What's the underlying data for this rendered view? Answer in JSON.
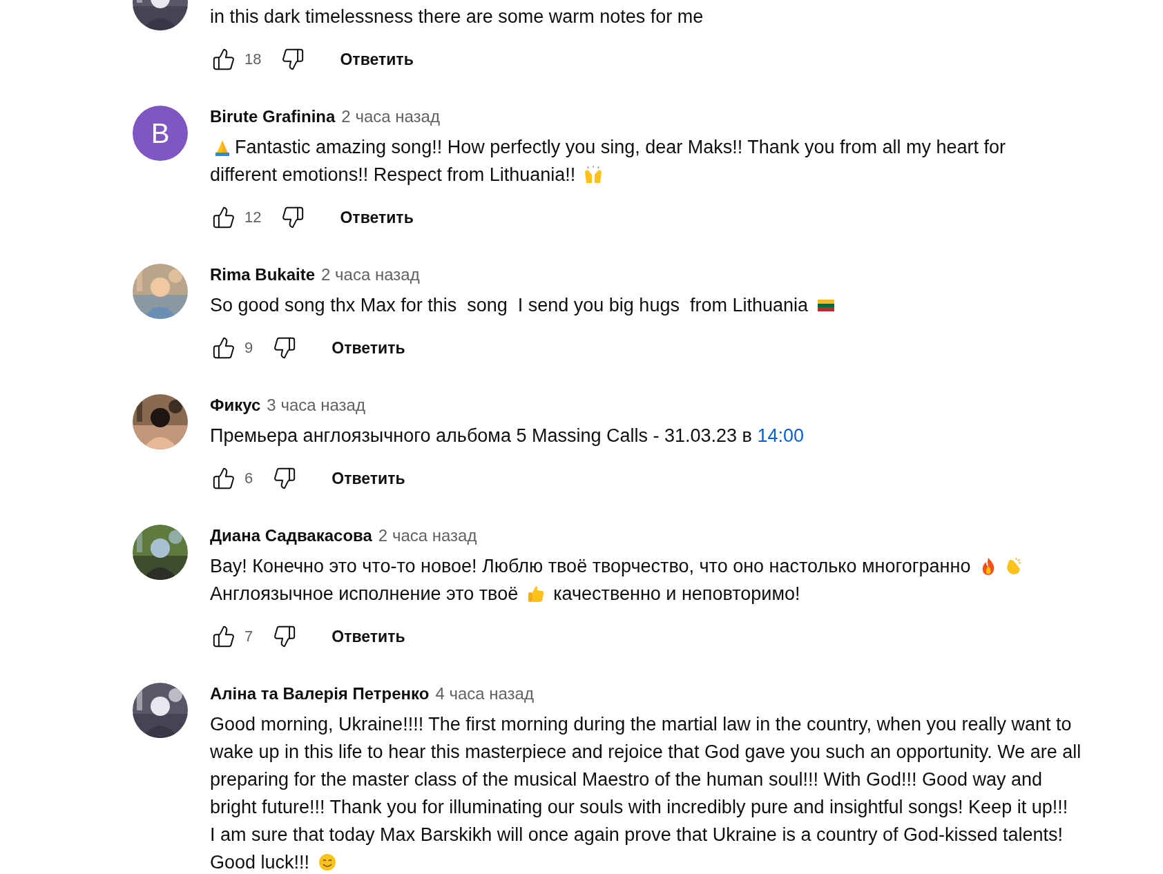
{
  "comments": [
    {
      "avatar": {
        "kind": "picture"
      },
      "lines": [
        [
          {
            "kind": "text",
            "text": "in this dark timelessness there are some warm notes for me"
          }
        ]
      ],
      "likes": "18",
      "reply": "Ответить"
    },
    {
      "author": "Birute Grafinina",
      "time": "2 часа назад",
      "avatar": {
        "kind": "letter",
        "letter": "B",
        "color": "#7e57c2"
      },
      "lines": [
        [
          {
            "kind": "pray"
          },
          {
            "kind": "text",
            "text": "Fantastic amazing song!! How perfectly you sing, dear Maks!! Thank you from all my heart for"
          }
        ],
        [
          {
            "kind": "text",
            "text": "different emotions!! Respect from Lithuania!! "
          },
          {
            "kind": "raised-hands"
          }
        ]
      ],
      "likes": "12",
      "reply": "Ответить"
    },
    {
      "author": "Rima Bukaite",
      "time": "2 часа назад",
      "avatar": {
        "kind": "picture"
      },
      "lines": [
        [
          {
            "kind": "text",
            "text": "So good song thx Max for this  song  I send you big hugs  from Lithuania "
          },
          {
            "kind": "flag"
          }
        ]
      ],
      "likes": "9",
      "reply": "Ответить"
    },
    {
      "author": "Фикус",
      "time": "3 часа назад",
      "avatar": {
        "kind": "picture"
      },
      "lines": [
        [
          {
            "kind": "text",
            "text": "Премьера англоязычного альбома 5 Massing Calls - 31.03.23 в "
          },
          {
            "kind": "link",
            "text": "14:00"
          }
        ]
      ],
      "likes": "6",
      "reply": "Ответить"
    },
    {
      "author": "Диана Садвакасова",
      "time": "2 часа назад",
      "avatar": {
        "kind": "picture"
      },
      "lines": [
        [
          {
            "kind": "text",
            "text": "Вау! Конечно это что-то новое! Люблю твоё творчество, что оно настолько многогранно "
          },
          {
            "kind": "fire"
          },
          {
            "kind": "clap"
          }
        ],
        [
          {
            "kind": "text",
            "text": "Англоязычное исполнение это твоё "
          },
          {
            "kind": "thumbs-up"
          },
          {
            "kind": "text",
            "text": " качественно и неповторимо!"
          }
        ]
      ],
      "likes": "7",
      "reply": "Ответить"
    },
    {
      "author": "Аліна та Валерія Петренко",
      "time": "4 часа назад",
      "avatar": {
        "kind": "picture"
      },
      "lines": [
        [
          {
            "kind": "text",
            "text": "Good morning, Ukraine!!!! The first morning during the martial law in the country, when you really want to"
          }
        ],
        [
          {
            "kind": "text",
            "text": "wake up in this life to hear this masterpiece and rejoice that God gave you such an opportunity. We are all"
          }
        ],
        [
          {
            "kind": "text",
            "text": "preparing for the master class of the musical Maestro of the human soul!!! With God!!! Good way and"
          }
        ],
        [
          {
            "kind": "text",
            "text": "bright future!!! Thank you for illuminating our souls with incredibly pure and insightful songs! Keep it up!!!"
          }
        ],
        [
          {
            "kind": "text",
            "text": "I am sure that today Max Barskikh will once again prove that Ukraine is a country of God-kissed talents!"
          }
        ],
        [
          {
            "kind": "text",
            "text": "Good luck!!! "
          },
          {
            "kind": "smile"
          }
        ]
      ]
    }
  ]
}
